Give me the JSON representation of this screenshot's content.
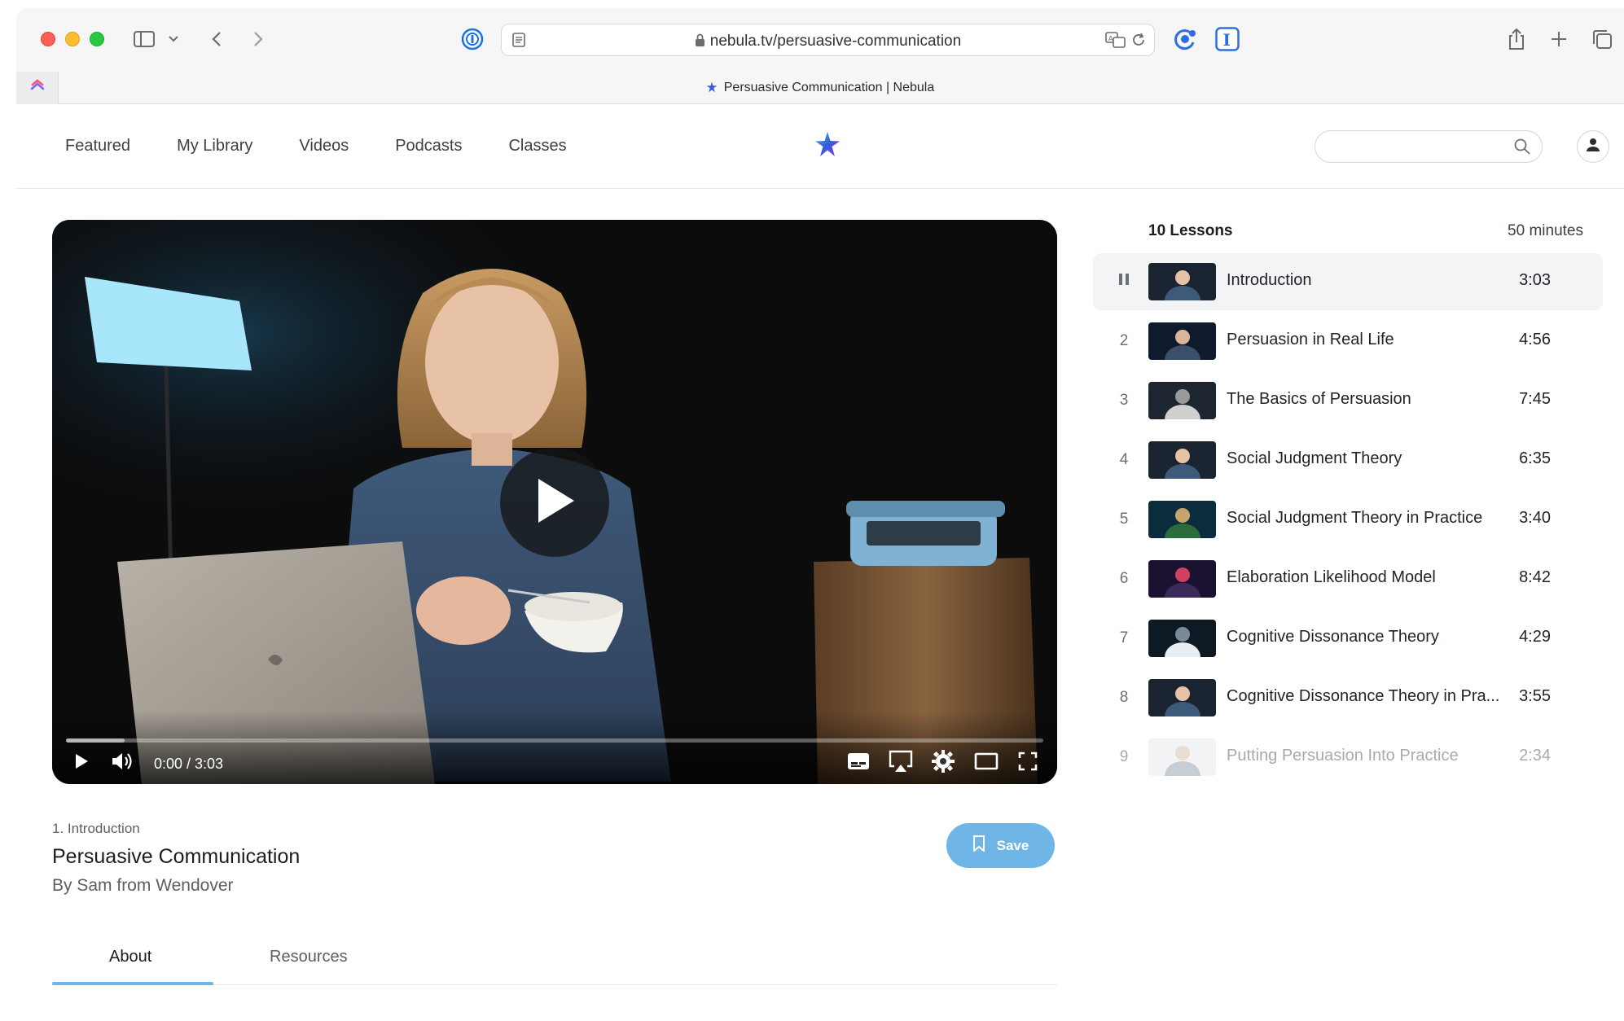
{
  "browser": {
    "url": "nebula.tv/persuasive-communication",
    "tab_title": "Persuasive Communication | Nebula"
  },
  "nav": {
    "items": [
      "Featured",
      "My Library",
      "Videos",
      "Podcasts",
      "Classes"
    ]
  },
  "search": {
    "placeholder": ""
  },
  "player": {
    "time": "0:00 / 3:03",
    "progress": 0.06
  },
  "video": {
    "lesson_label": "1. Introduction",
    "title": "Persuasive Communication",
    "author": "By Sam from Wendover",
    "save_label": "Save"
  },
  "tabs": [
    "About",
    "Resources"
  ],
  "lessons": {
    "count_label": "10 Lessons",
    "total_label": "50 minutes",
    "items": [
      {
        "num": "",
        "title": "Introduction",
        "duration": "3:03",
        "state": "playing"
      },
      {
        "num": "2",
        "title": "Persuasion in Real Life",
        "duration": "4:56",
        "state": ""
      },
      {
        "num": "3",
        "title": "The Basics of Persuasion",
        "duration": "7:45",
        "state": ""
      },
      {
        "num": "4",
        "title": "Social Judgment Theory",
        "duration": "6:35",
        "state": ""
      },
      {
        "num": "5",
        "title": "Social Judgment Theory in Practice",
        "duration": "3:40",
        "state": ""
      },
      {
        "num": "6",
        "title": "Elaboration Likelihood Model",
        "duration": "8:42",
        "state": ""
      },
      {
        "num": "7",
        "title": "Cognitive Dissonance Theory",
        "duration": "4:29",
        "state": ""
      },
      {
        "num": "8",
        "title": "Cognitive Dissonance Theory in Pra...",
        "duration": "3:55",
        "state": ""
      },
      {
        "num": "9",
        "title": "Putting Persuasion Into Practice",
        "duration": "2:34",
        "state": "faded"
      }
    ]
  },
  "colors": {
    "accent": "#6fb6e6",
    "brand_star": "#3a5bd9"
  }
}
